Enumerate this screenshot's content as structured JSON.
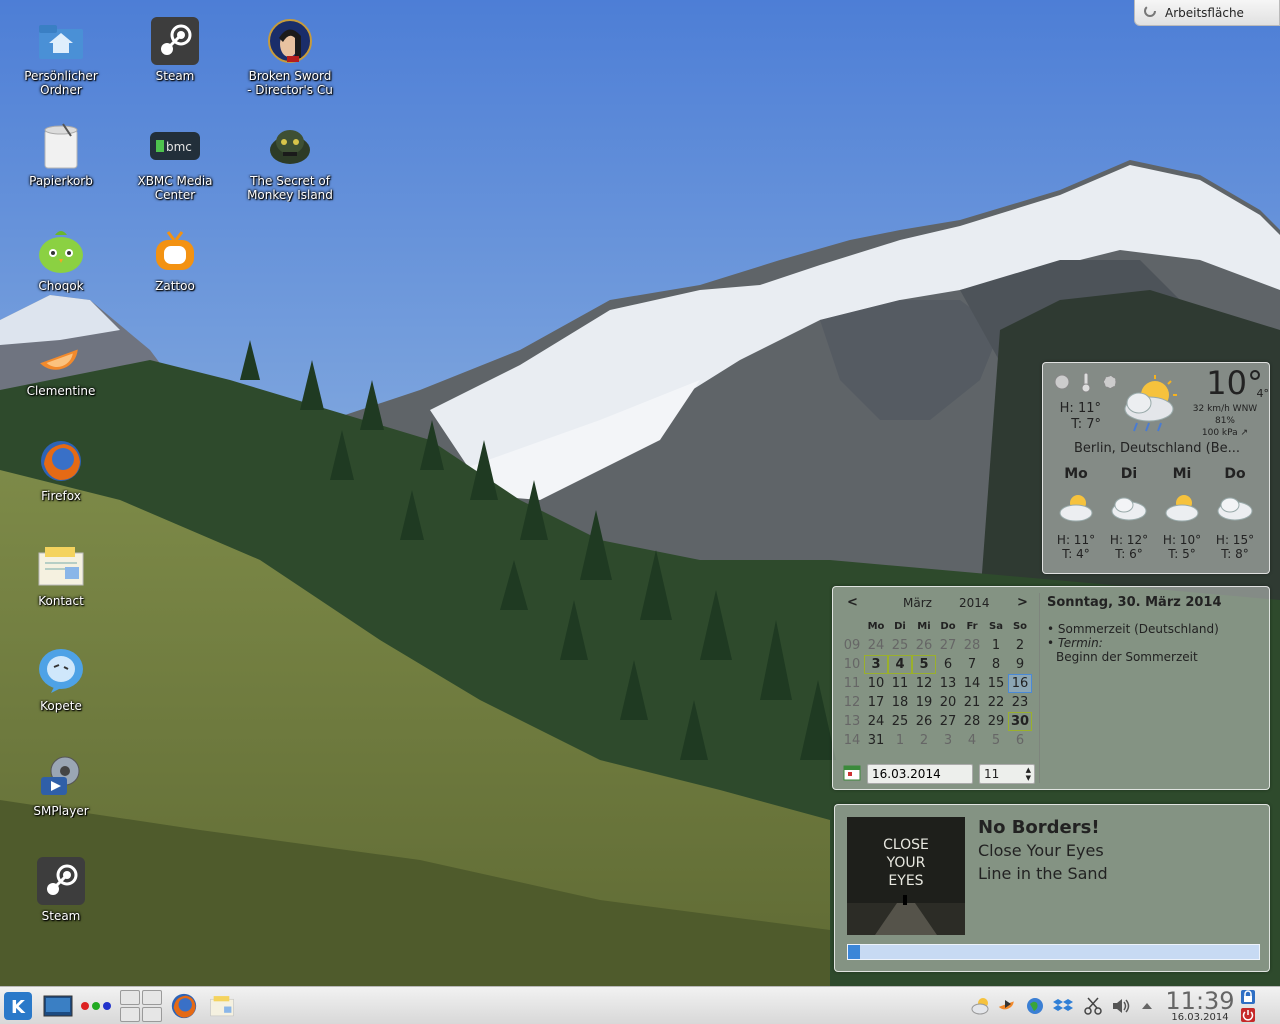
{
  "desktop": {
    "icons": [
      {
        "label": "Persönlicher\nOrdner",
        "icon": "home-folder-icon"
      },
      {
        "label": "Steam",
        "icon": "steam-icon"
      },
      {
        "label": "Broken Sword\n- Director's Cu",
        "icon": "broken-sword-icon"
      },
      {
        "label": "Papierkorb",
        "icon": "trash-icon"
      },
      {
        "label": "XBMC Media\nCenter",
        "icon": "xbmc-icon"
      },
      {
        "label": "The Secret of\nMonkey Island",
        "icon": "monkey-island-icon"
      },
      {
        "label": "Choqok",
        "icon": "choqok-icon"
      },
      {
        "label": "Zattoo",
        "icon": "zattoo-icon"
      },
      {
        "label": "Clementine",
        "icon": "clementine-icon"
      },
      {
        "label": "Firefox",
        "icon": "firefox-icon"
      },
      {
        "label": "Kontact",
        "icon": "kontact-icon"
      },
      {
        "label": "Kopete",
        "icon": "kopete-icon"
      },
      {
        "label": "SMPlayer",
        "icon": "smplayer-icon"
      },
      {
        "label": "Steam",
        "icon": "steam-icon"
      }
    ]
  },
  "toolbox": {
    "label": "Arbeitsfläche",
    "icon": "cashew-icon"
  },
  "weather": {
    "current_temp": "10°",
    "feels_like": "4°",
    "high": "H: 11°",
    "low": "T: 7°",
    "wind": "32 km/h WNW",
    "humidity": "81%",
    "pressure": "100 kPa ↗",
    "location": "Berlin, Deutschland (Be...",
    "condition_icon": "cloudy-rain-sun-icon",
    "forecast": [
      {
        "day": "Mo",
        "high": "H: 11°",
        "low": "T: 4°",
        "icon": "partly-cloudy-icon"
      },
      {
        "day": "Di",
        "high": "H: 12°",
        "low": "T: 6°",
        "icon": "cloudy-icon"
      },
      {
        "day": "Mi",
        "high": "H: 10°",
        "low": "T: 5°",
        "icon": "partly-cloudy-icon"
      },
      {
        "day": "Do",
        "high": "H: 15°",
        "low": "T: 8°",
        "icon": "cloudy-icon"
      }
    ]
  },
  "calendar": {
    "prev": "<",
    "next": ">",
    "month": "März",
    "year": "2014",
    "weekday_headers": [
      "Mo",
      "Di",
      "Mi",
      "Do",
      "Fr",
      "Sa",
      "So"
    ],
    "weeks": [
      {
        "wk": "09",
        "days": [
          "24",
          "25",
          "26",
          "27",
          "28",
          "1",
          "2"
        ]
      },
      {
        "wk": "10",
        "days": [
          "3",
          "4",
          "5",
          "6",
          "7",
          "8",
          "9"
        ]
      },
      {
        "wk": "11",
        "days": [
          "10",
          "11",
          "12",
          "13",
          "14",
          "15",
          "16"
        ]
      },
      {
        "wk": "12",
        "days": [
          "17",
          "18",
          "19",
          "20",
          "21",
          "22",
          "23"
        ]
      },
      {
        "wk": "13",
        "days": [
          "24",
          "25",
          "26",
          "27",
          "28",
          "29",
          "30"
        ]
      },
      {
        "wk": "14",
        "days": [
          "31",
          "1",
          "2",
          "3",
          "4",
          "5",
          "6"
        ]
      }
    ],
    "date_value": "16.03.2014",
    "week_value": "11",
    "agenda_title": "Sonntag, 30. März 2014",
    "agenda_items": [
      {
        "prefix": "",
        "text": "Sommerzeit (Deutschland)"
      },
      {
        "prefix": "Termin:",
        "text": "Beginn der Sommerzeit"
      }
    ]
  },
  "now_playing": {
    "artist": "No Borders!",
    "album": "Close Your Eyes",
    "track": "Line in the Sand",
    "cover_text": [
      "CLOSE",
      "YOUR",
      "EYES"
    ],
    "progress": 0.03
  },
  "taskbar": {
    "clock_time": "11:39",
    "clock_date": "16.03.2014"
  }
}
